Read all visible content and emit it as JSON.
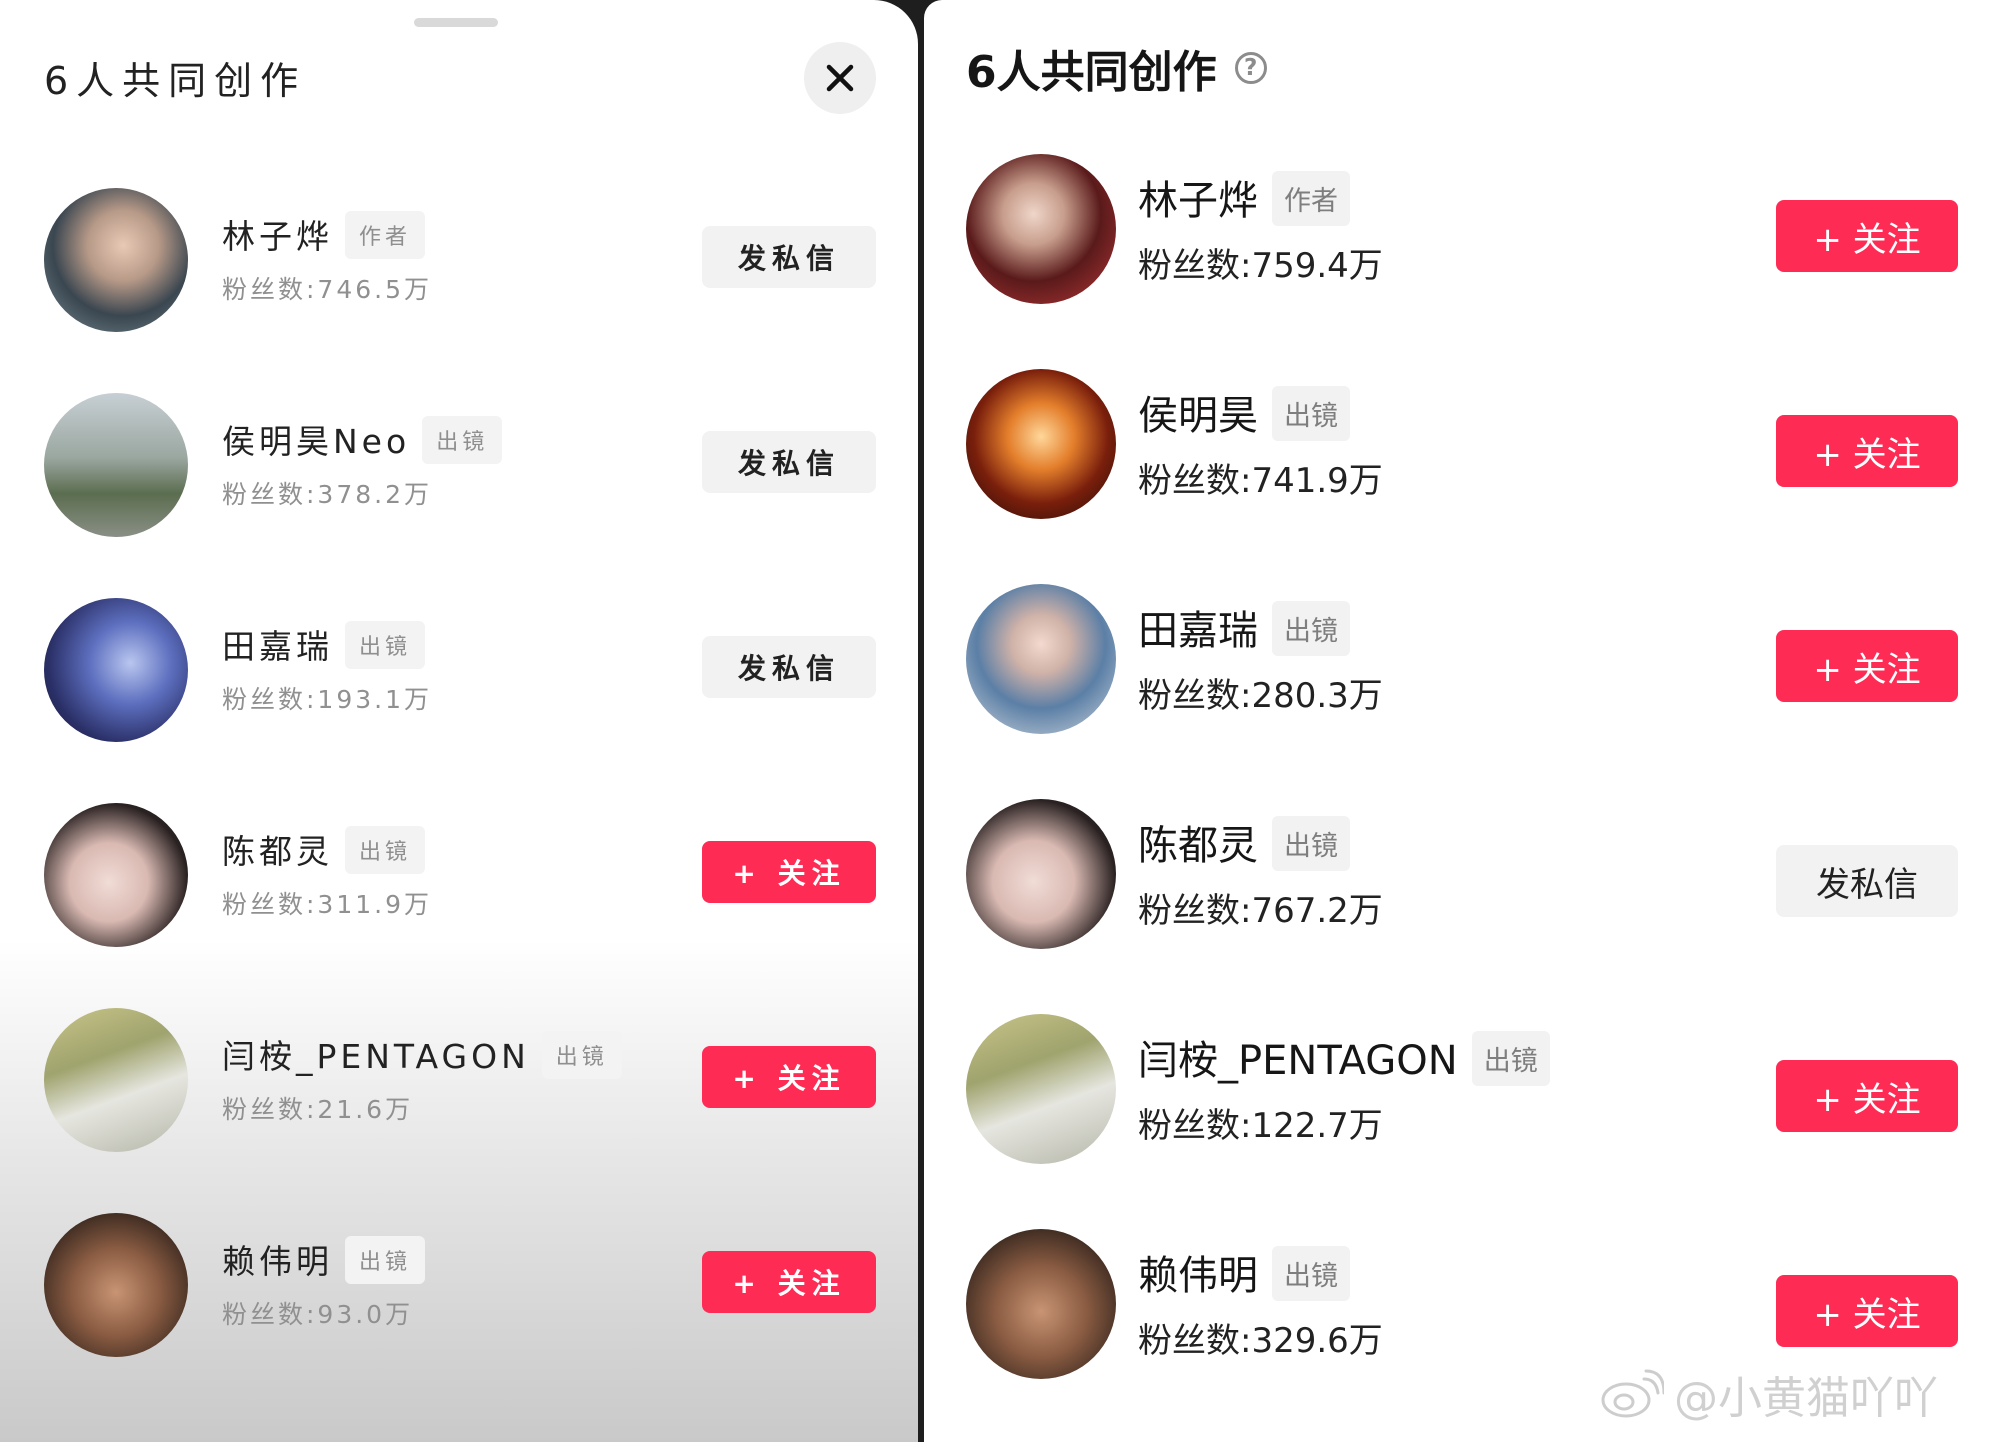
{
  "left": {
    "title": "6人共同创作",
    "members": [
      {
        "name": "林子烨",
        "role": "作者",
        "fans": "粉丝数:746.5万",
        "button": "发私信",
        "button_type": "message",
        "avatar_bg": "radial-gradient(circle at 55% 40%, #e8c9b6 0%, #b89a88 30%, #3a4650 60%, #7a8f95 100%)"
      },
      {
        "name": "侯明昊Neo",
        "role": "出镜",
        "fans": "粉丝数:378.2万",
        "button": "发私信",
        "button_type": "message",
        "avatar_bg": "linear-gradient(180deg, #c7cfd4 0%, #9aa7a0 45%, #5b6d4f 70%, #8a8f86 100%)"
      },
      {
        "name": "田嘉瑞",
        "role": "出镜",
        "fans": "粉丝数:193.1万",
        "button": "发私信",
        "button_type": "message",
        "avatar_bg": "radial-gradient(circle at 60% 45%, #b9c6ef 0%, #5d6fbf 35%, #2a2f66 70%, #16193a 100%)"
      },
      {
        "name": "陈都灵",
        "role": "出镜",
        "fans": "粉丝数:311.9万",
        "button": "+ 关注",
        "button_type": "follow",
        "avatar_bg": "radial-gradient(circle at 45% 55%, #f1dcd6 0%, #d9b9b2 35%, #2a2222 70%, #1a1616 100%)"
      },
      {
        "name": "闫桉_PENTAGON",
        "role": "出镜",
        "fans": "粉丝数:21.6万",
        "button": "+ 关注",
        "button_type": "follow",
        "avatar_bg": "linear-gradient(160deg, #c9c58a 0%, #9fa36d 35%, #e6e6e0 60%, #b5b6a8 100%)"
      },
      {
        "name": "赖伟明",
        "role": "出镜",
        "fans": "粉丝数:93.0万",
        "button": "+ 关注",
        "button_type": "follow",
        "avatar_bg": "radial-gradient(circle at 50% 55%, #c89474 0%, #8c5d43 40%, #3f2c22 75%, #1f1914 100%)"
      }
    ]
  },
  "right": {
    "title": "6人共同创作",
    "members": [
      {
        "name": "林子烨",
        "role": "作者",
        "fans": "粉丝数:759.4万",
        "button": "+ 关注",
        "button_type": "follow",
        "avatar_bg": "radial-gradient(circle at 45% 40%, #efd6c9 0%, #c89e8d 25%, #5a1a1a 55%, #b9373a 100%)"
      },
      {
        "name": "侯明昊",
        "role": "出镜",
        "fans": "粉丝数:741.9万",
        "button": "+ 关注",
        "button_type": "follow",
        "avatar_bg": "radial-gradient(circle at 50% 45%, #ffd79a 0%, #e37e2b 30%, #7a1f0c 60%, #1c0a06 100%)"
      },
      {
        "name": "田嘉瑞",
        "role": "出镜",
        "fans": "粉丝数:280.3万",
        "button": "+ 关注",
        "button_type": "follow",
        "avatar_bg": "radial-gradient(circle at 50% 40%, #f3d9cf 0%, #cfb2a8 25%, #5b7fa6 55%, #cfd6dd 100%)"
      },
      {
        "name": "陈都灵",
        "role": "出镜",
        "fans": "粉丝数:767.2万",
        "button": "发私信",
        "button_type": "message",
        "avatar_bg": "radial-gradient(circle at 45% 55%, #f1dcd6 0%, #d9b9b2 35%, #2a2222 70%, #1a1616 100%)"
      },
      {
        "name": "闫桉_PENTAGON",
        "role": "出镜",
        "fans": "粉丝数:122.7万",
        "button": "+ 关注",
        "button_type": "follow",
        "avatar_bg": "linear-gradient(160deg, #c9c58a 0%, #9fa36d 35%, #e6e6e0 60%, #b5b6a8 100%)"
      },
      {
        "name": "赖伟明",
        "role": "出镜",
        "fans": "粉丝数:329.6万",
        "button": "+ 关注",
        "button_type": "follow",
        "avatar_bg": "radial-gradient(circle at 50% 55%, #c89474 0%, #8c5d43 40%, #3f2c22 75%, #1f1914 100%)"
      }
    ]
  },
  "help_icon": "?",
  "close_icon": "close-icon",
  "watermark": "@小黄猫吖吖",
  "colors": {
    "follow": "#fe2c55",
    "message_bg": "#f2f2f2"
  }
}
